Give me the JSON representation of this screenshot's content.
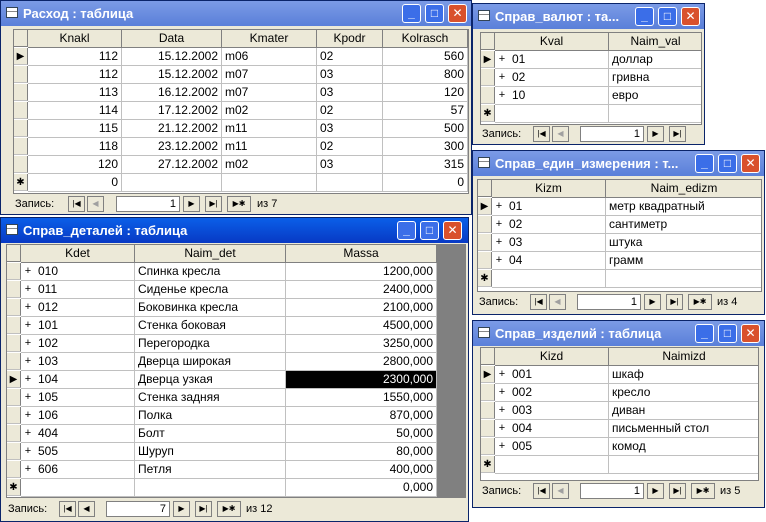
{
  "rashod": {
    "title": "Расход : таблица",
    "columns": [
      "Knakl",
      "Data",
      "Kmater",
      "Kpodr",
      "Kolrasch"
    ],
    "rows": [
      [
        "112",
        "15.12.2002",
        "m06",
        "02",
        "560"
      ],
      [
        "112",
        "15.12.2002",
        "m07",
        "03",
        "800"
      ],
      [
        "113",
        "16.12.2002",
        "m07",
        "03",
        "120"
      ],
      [
        "114",
        "17.12.2002",
        "m02",
        "02",
        "57"
      ],
      [
        "115",
        "21.12.2002",
        "m11",
        "03",
        "500"
      ],
      [
        "118",
        "23.12.2002",
        "m11",
        "02",
        "300"
      ],
      [
        "120",
        "27.12.2002",
        "m02",
        "03",
        "315"
      ]
    ],
    "new_row": [
      "0",
      "",
      "",
      "",
      "0"
    ],
    "nav": {
      "label": "Запись:",
      "current": "1",
      "of": "из 7"
    }
  },
  "sprav_valut": {
    "title": "Справ_валют : та...",
    "columns": [
      "Kval",
      "Naim_val"
    ],
    "rows": [
      [
        "01",
        "доллар"
      ],
      [
        "02",
        "гривна"
      ],
      [
        "10",
        "евро"
      ]
    ],
    "nav": {
      "label": "Запись:",
      "current": "1",
      "of": ""
    }
  },
  "sprav_edin": {
    "title": "Справ_един_измерения : т...",
    "columns": [
      "Kizm",
      "Naim_edizm"
    ],
    "rows": [
      [
        "01",
        "метр квадратный"
      ],
      [
        "02",
        "сантиметр"
      ],
      [
        "03",
        "штука"
      ],
      [
        "04",
        "грамм"
      ]
    ],
    "nav": {
      "label": "Запись:",
      "current": "1",
      "of": "из 4"
    }
  },
  "sprav_detaley": {
    "title": "Справ_деталей : таблица",
    "columns": [
      "Kdet",
      "Naim_det",
      "Massa"
    ],
    "rows": [
      [
        "010",
        "Спинка кресла",
        "1200,000"
      ],
      [
        "011",
        "Сиденье кресла",
        "2400,000"
      ],
      [
        "012",
        "Боковинка кресла",
        "2100,000"
      ],
      [
        "101",
        "Стенка боковая",
        "4500,000"
      ],
      [
        "102",
        "Перегородка",
        "3250,000"
      ],
      [
        "103",
        "Дверца широкая",
        "2800,000"
      ],
      [
        "104",
        "Дверца узкая",
        "2300,000"
      ],
      [
        "105",
        "Стенка задняя",
        "1550,000"
      ],
      [
        "106",
        "Полка",
        "870,000"
      ],
      [
        "404",
        "Болт",
        "50,000"
      ],
      [
        "505",
        "Шуруп",
        "80,000"
      ],
      [
        "606",
        "Петля",
        "400,000"
      ]
    ],
    "new_row": [
      "",
      "",
      "0,000"
    ],
    "nav": {
      "label": "Запись:",
      "current": "7",
      "of": "из 12"
    }
  },
  "sprav_izdeliy": {
    "title": "Справ_изделий : таблица",
    "columns": [
      "Kizd",
      "Naimizd"
    ],
    "rows": [
      [
        "001",
        "шкаф"
      ],
      [
        "002",
        "кресло"
      ],
      [
        "003",
        "диван"
      ],
      [
        "004",
        "письменный стол"
      ],
      [
        "005",
        "комод"
      ]
    ],
    "nav": {
      "label": "Запись:",
      "current": "1",
      "of": "из 5"
    }
  },
  "glyphs": {
    "min": "_",
    "max": "□",
    "close": "✕",
    "current": "▶",
    "new": "✱",
    "plus": "+",
    "first": "|◀",
    "prev": "◀",
    "next": "▶",
    "last": "▶|",
    "add": "▶✱"
  },
  "colors": {
    "title_active": "#0839c4",
    "title_inactive": "#7b9be6",
    "selected_cell": "#000000"
  }
}
